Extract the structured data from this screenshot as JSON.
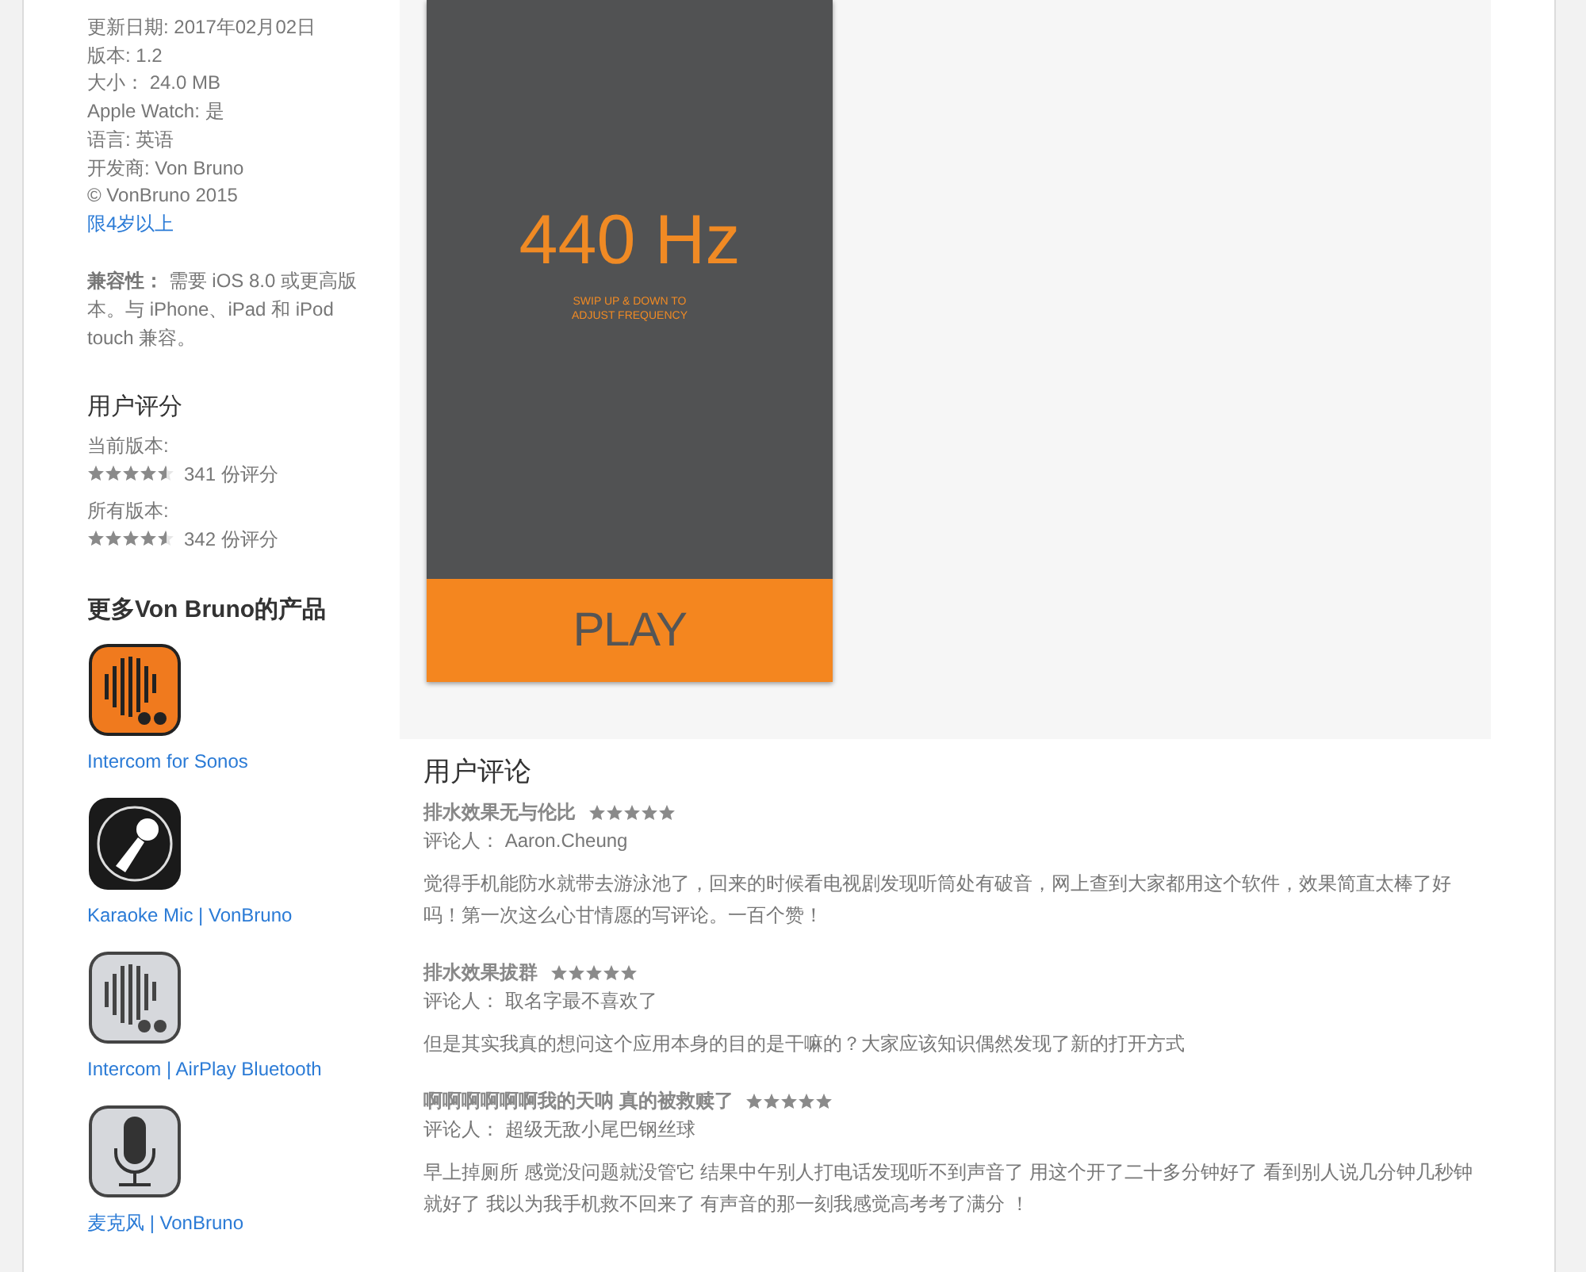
{
  "info": [
    {
      "text": "更新日期: 2017年02月02日",
      "kind": "plain"
    },
    {
      "text": "版本: 1.2",
      "kind": "plain"
    },
    {
      "text": "大小： 24.0 MB",
      "kind": "plain"
    },
    {
      "text": "Apple Watch: 是",
      "kind": "plain"
    },
    {
      "text": "语言: 英语",
      "kind": "plain"
    },
    {
      "text": "开发商: Von Bruno",
      "kind": "plain"
    },
    {
      "text": "© VonBruno 2015",
      "kind": "plain"
    },
    {
      "text": "限4岁以上",
      "kind": "link"
    }
  ],
  "compatibility": "**兼容性：** 需要 iOS 8.0 或更高版本。与 iPhone、iPad 和 iPod touch 兼容。",
  "ratings": {
    "title": "用户评分",
    "groups": [
      {
        "label": "当前版本:",
        "stars": 4.5,
        "count": "341 份评分"
      },
      {
        "label": "所有版本:",
        "stars": 4.5,
        "count": "342 份评分"
      }
    ]
  },
  "more_apps": {
    "title": "更多Von Bruno的产品",
    "items": [
      {
        "kind": "intercom-orange",
        "name": "Intercom for Sonos"
      },
      {
        "kind": "karaoke",
        "name": "Karaoke Mic | VonBruno"
      },
      {
        "kind": "intercom-gray",
        "name": "Intercom | AirPlay Bluetooth"
      },
      {
        "kind": "mic",
        "name": "麦克风 | VonBruno"
      }
    ]
  },
  "screenshot": {
    "frequency": "440 Hz",
    "hint": [
      "SWIP UP & DOWN TO",
      "ADJUST FREQUENCY"
    ],
    "button": "PLAY"
  },
  "reviews": {
    "title": "用户评论",
    "items": [
      {
        "title": "排水效果无与伦比",
        "stars": 5,
        "reviewer": "评论人： Aaron.Cheung",
        "body": "觉得手机能防水就带去游泳池了，回来的时候看电视剧发现听筒处有破音，网上查到大家都用这个软件，效果简直太棒了好吗！第一次这么心甘情愿的写评论。一百个赞！"
      },
      {
        "title": "排水效果拔群",
        "stars": 5,
        "reviewer": "评论人： 取名字最不喜欢了",
        "body": "但是其实我真的想问这个应用本身的目的是干嘛的？大家应该知识偶然发现了新的打开方式"
      },
      {
        "title": "啊啊啊啊啊啊我的天呐 真的被救赎了",
        "stars": 5,
        "reviewer": "评论人： 超级无敌小尾巴钢丝球",
        "body": "早上掉厕所 感觉没问题就没管它 结果中午别人打电话发现听不到声音了 用这个开了二十多分钟好了 看到别人说几分钟几秒钟就好了 我以为我手机救不回来了 有声音的那一刻我感觉高考考了满分 ！"
      }
    ]
  }
}
